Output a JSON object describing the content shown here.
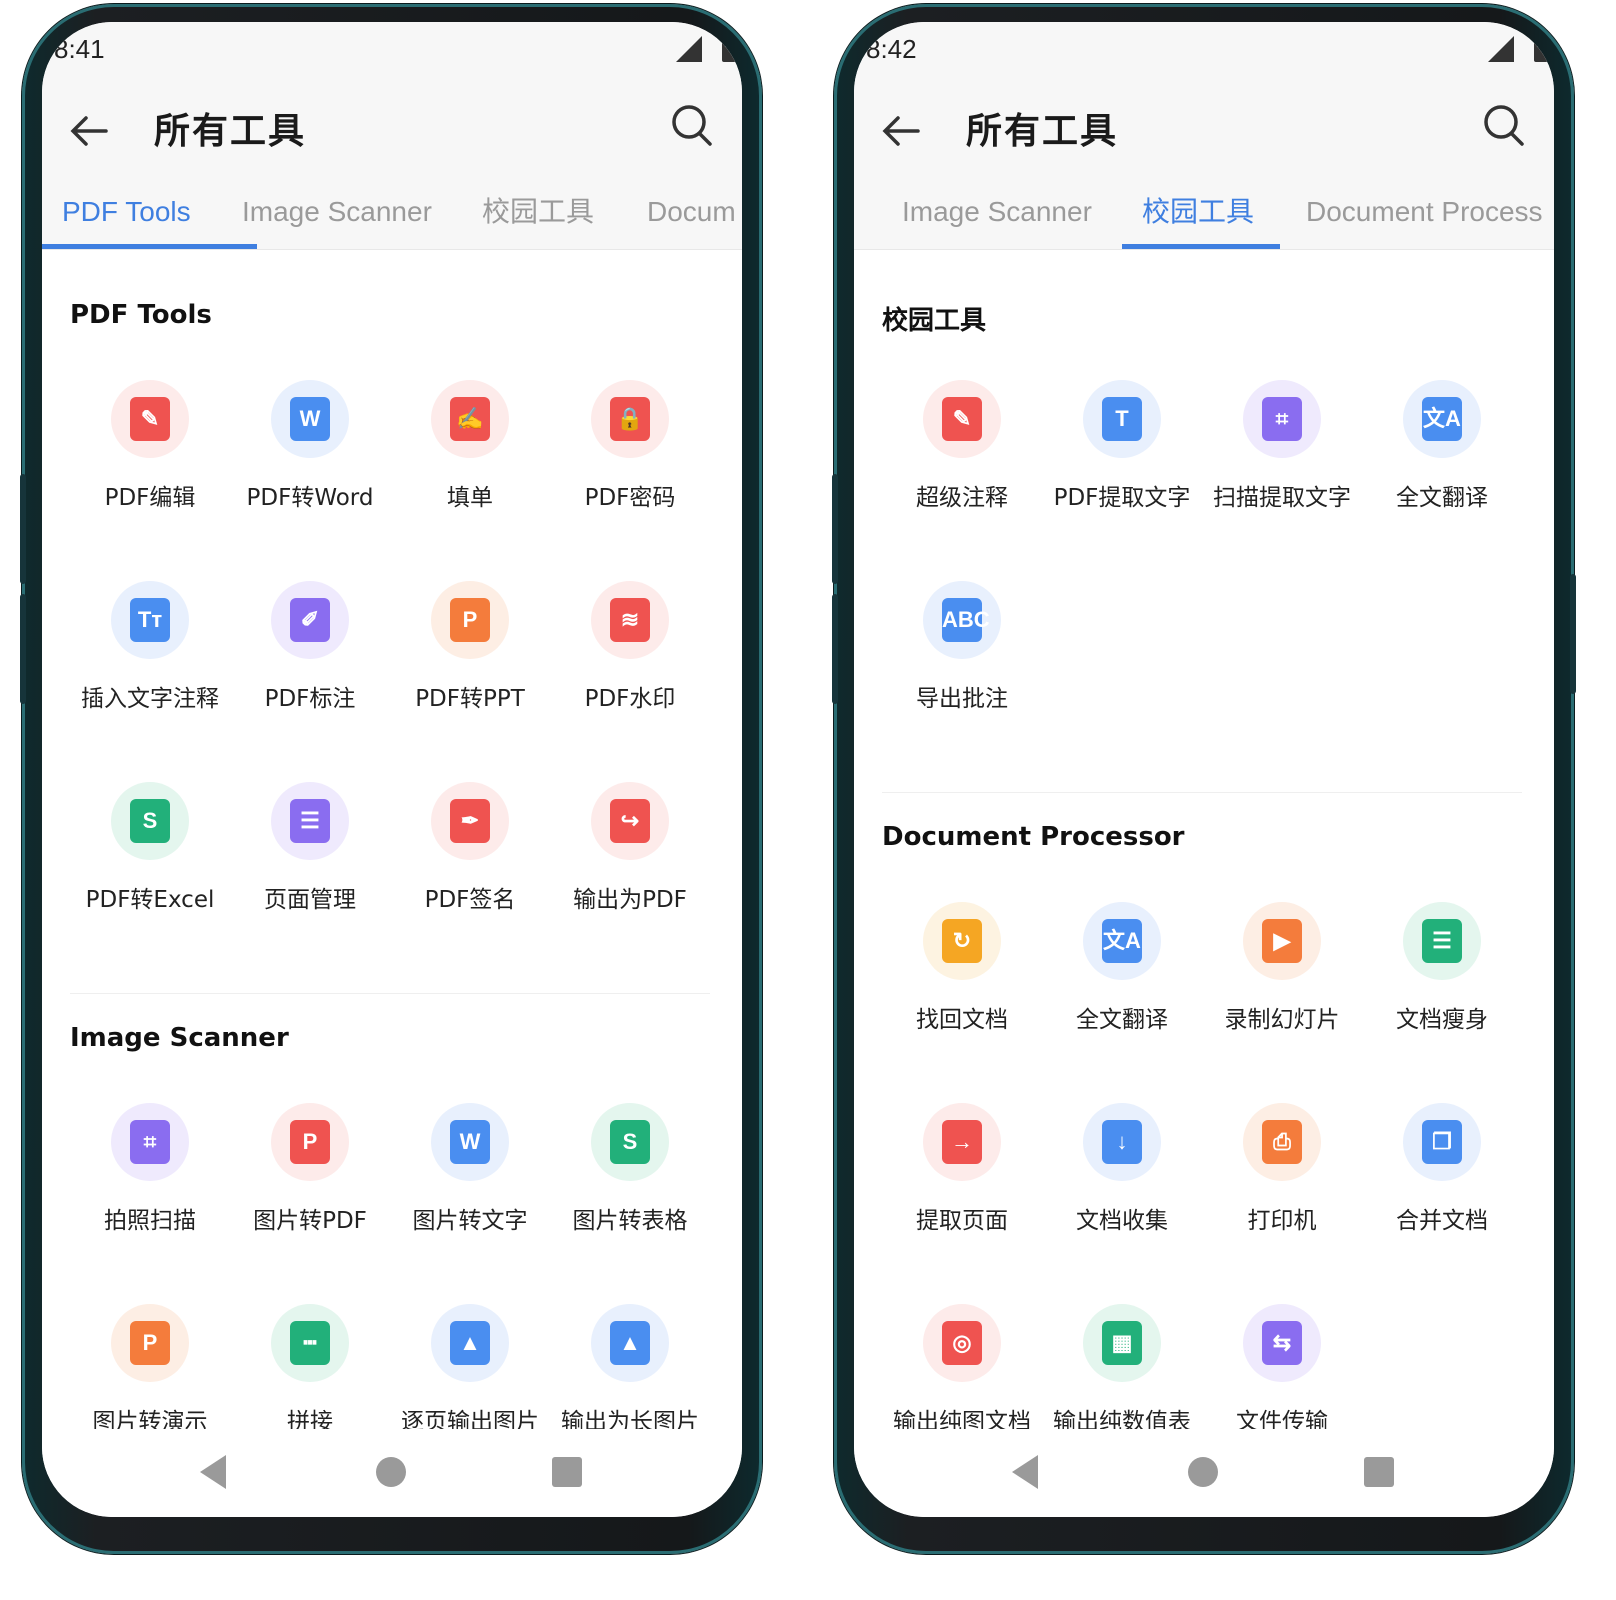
{
  "colors": {
    "accent": "#3f7fe0",
    "red": "#ef5350",
    "blue": "#4a8ef0",
    "purple": "#8a6df0",
    "green": "#22b07a",
    "orange": "#f47c3c",
    "yellow": "#f5a623"
  },
  "left": {
    "status": {
      "time": "8:41"
    },
    "appbar": {
      "title": "所有工具"
    },
    "tabs": [
      {
        "label": "PDF Tools",
        "active": true
      },
      {
        "label": "Image Scanner",
        "active": false
      },
      {
        "label": "校园工具",
        "active": false
      },
      {
        "label": "Docum",
        "active": false
      }
    ],
    "sections": [
      {
        "title": "PDF Tools",
        "tools": [
          {
            "label": "PDF编辑",
            "icon": "pdf-edit-icon",
            "color": "red"
          },
          {
            "label": "PDF转Word",
            "icon": "pdf-to-word-icon",
            "color": "blue"
          },
          {
            "label": "填单",
            "icon": "form-fill-icon",
            "color": "red"
          },
          {
            "label": "PDF密码",
            "icon": "lock-icon",
            "color": "red"
          },
          {
            "label": "插入文字注释",
            "icon": "text-annotation-icon",
            "color": "blue"
          },
          {
            "label": "PDF标注",
            "icon": "markup-icon",
            "color": "purple"
          },
          {
            "label": "PDF转PPT",
            "icon": "pdf-to-ppt-icon",
            "color": "orange"
          },
          {
            "label": "PDF水印",
            "icon": "watermark-icon",
            "color": "red"
          },
          {
            "label": "PDF转Excel",
            "icon": "pdf-to-excel-icon",
            "color": "green"
          },
          {
            "label": "页面管理",
            "icon": "page-manage-icon",
            "color": "purple"
          },
          {
            "label": "PDF签名",
            "icon": "signature-icon",
            "color": "red"
          },
          {
            "label": "输出为PDF",
            "icon": "export-pdf-icon",
            "color": "red"
          }
        ]
      },
      {
        "title": "Image Scanner",
        "tools": [
          {
            "label": "拍照扫描",
            "icon": "photo-scan-icon",
            "color": "purple"
          },
          {
            "label": "图片转PDF",
            "icon": "image-to-pdf-icon",
            "color": "red"
          },
          {
            "label": "图片转文字",
            "icon": "image-to-text-icon",
            "color": "blue"
          },
          {
            "label": "图片转表格",
            "icon": "image-to-sheet-icon",
            "color": "green"
          },
          {
            "label": "图片转演示",
            "icon": "image-to-slides-icon",
            "color": "orange"
          },
          {
            "label": "拼接",
            "icon": "stitch-icon",
            "color": "green"
          },
          {
            "label": "逐页输出图片",
            "icon": "export-pages-image-icon",
            "color": "blue"
          },
          {
            "label": "输出为长图片",
            "icon": "export-long-image-icon",
            "color": "blue"
          }
        ]
      }
    ]
  },
  "right": {
    "status": {
      "time": "8:42"
    },
    "appbar": {
      "title": "所有工具"
    },
    "tabs": [
      {
        "label": "Image Scanner",
        "active": false
      },
      {
        "label": "校园工具",
        "active": true
      },
      {
        "label": "Document Process",
        "active": false
      }
    ],
    "sections": [
      {
        "title": "校园工具",
        "tools": [
          {
            "label": "超级注释",
            "icon": "super-annotation-icon",
            "color": "red"
          },
          {
            "label": "PDF提取文字",
            "icon": "extract-text-icon",
            "color": "blue"
          },
          {
            "label": "扫描提取文字",
            "icon": "scan-extract-text-icon",
            "color": "purple"
          },
          {
            "label": "全文翻译",
            "icon": "translate-icon",
            "color": "blue"
          },
          {
            "label": "导出批注",
            "icon": "export-annotation-icon",
            "color": "blue"
          }
        ]
      },
      {
        "title": "Document Processor",
        "tools": [
          {
            "label": "找回文档",
            "icon": "recover-doc-icon",
            "color": "yellow"
          },
          {
            "label": "全文翻译",
            "icon": "translate-icon",
            "color": "blue"
          },
          {
            "label": "录制幻灯片",
            "icon": "record-slides-icon",
            "color": "orange"
          },
          {
            "label": "文档瘦身",
            "icon": "slim-doc-icon",
            "color": "green"
          },
          {
            "label": "提取页面",
            "icon": "extract-page-icon",
            "color": "red"
          },
          {
            "label": "文档收集",
            "icon": "collect-doc-icon",
            "color": "blue"
          },
          {
            "label": "打印机",
            "icon": "printer-icon",
            "color": "orange"
          },
          {
            "label": "合并文档",
            "icon": "merge-doc-icon",
            "color": "blue"
          },
          {
            "label": "输出纯图文档",
            "icon": "export-image-doc-icon",
            "color": "red"
          },
          {
            "label": "输出纯数值表",
            "icon": "export-value-sheet-icon",
            "color": "green"
          },
          {
            "label": "文件传输",
            "icon": "file-transfer-icon",
            "color": "purple"
          }
        ]
      }
    ]
  }
}
